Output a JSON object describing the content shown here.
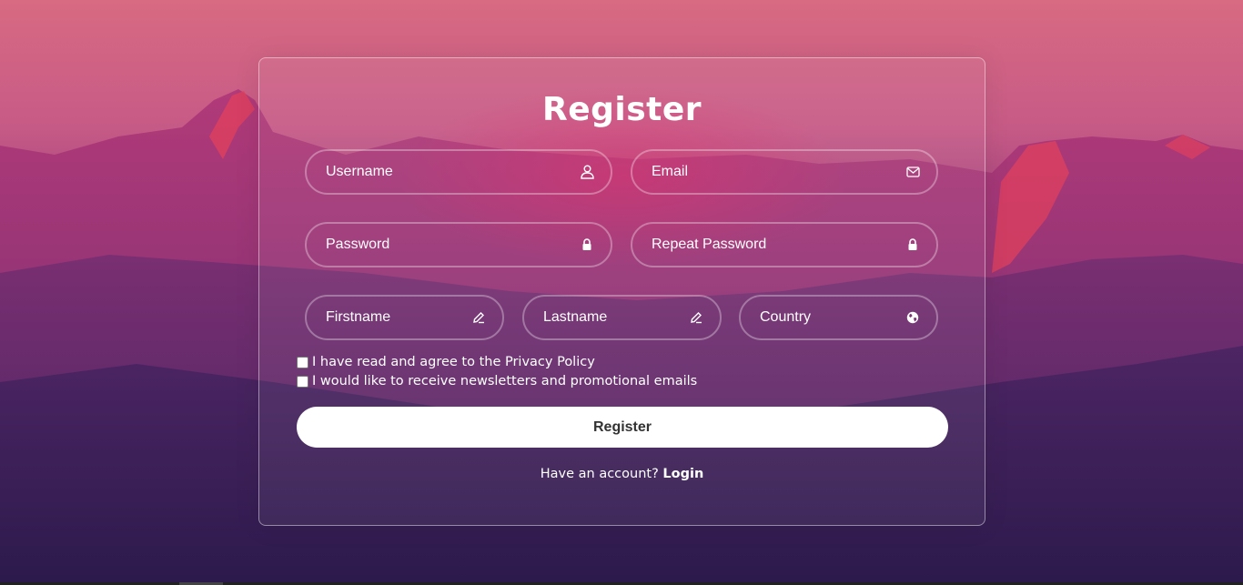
{
  "form": {
    "title": "Register",
    "fields": {
      "username": {
        "placeholder": "Username",
        "icon": "user-icon"
      },
      "email": {
        "placeholder": "Email",
        "icon": "envelope-icon"
      },
      "password": {
        "placeholder": "Password",
        "icon": "lock-icon"
      },
      "repeat_password": {
        "placeholder": "Repeat Password",
        "icon": "lock-icon"
      },
      "firstname": {
        "placeholder": "Firstname",
        "icon": "pencil-icon"
      },
      "lastname": {
        "placeholder": "Lastname",
        "icon": "pencil-icon"
      },
      "country": {
        "placeholder": "Country",
        "icon": "globe-icon"
      }
    },
    "checkboxes": {
      "privacy": {
        "label": "I have read and agree to the Privacy Policy",
        "checked": false
      },
      "newsletter": {
        "label": "I would like to receive newsletters and promotional emails",
        "checked": false
      }
    },
    "submit_label": "Register",
    "footer": {
      "prompt": "Have an account?",
      "link_label": "Login"
    }
  }
}
